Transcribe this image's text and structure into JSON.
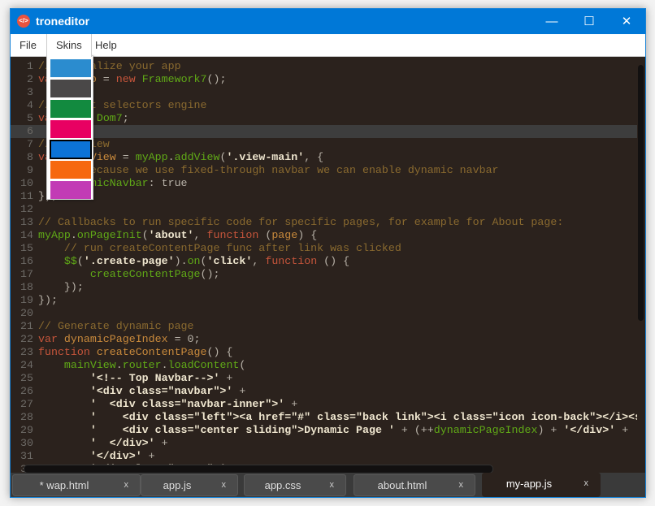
{
  "window": {
    "title": "troneditor",
    "logo_glyph": "</>"
  },
  "menu": [
    "File",
    "Skins",
    "Help"
  ],
  "skins": {
    "colors": [
      "#2b8ccf",
      "#4a4848",
      "#128a3f",
      "#e80062",
      "#0c73d6",
      "#f6680f",
      "#c23bb5"
    ],
    "selected_index": 4
  },
  "editor": {
    "current_line": 6,
    "lines": [
      [
        [
          "c",
          "// Initialize your app"
        ]
      ],
      [
        [
          "k",
          "var "
        ],
        [
          "v",
          "myApp"
        ],
        [
          "p",
          " = "
        ],
        [
          "k",
          "new "
        ],
        [
          "g",
          "Framework7"
        ],
        [
          "p",
          "();"
        ]
      ],
      [],
      [
        [
          "c",
          "// Export selectors engine"
        ]
      ],
      [
        [
          "k",
          "var "
        ],
        [
          "v",
          "$$"
        ],
        [
          "p",
          " = "
        ],
        [
          "g",
          "Dom7"
        ],
        [
          "p",
          ";"
        ]
      ],
      [],
      [
        [
          "c",
          "// Add view"
        ]
      ],
      [
        [
          "k",
          "var "
        ],
        [
          "v",
          "mainView"
        ],
        [
          "p",
          " = "
        ],
        [
          "g",
          "myApp"
        ],
        [
          "p",
          "."
        ],
        [
          "g",
          "addView"
        ],
        [
          "p",
          "("
        ],
        [
          "s",
          "'.view-main'"
        ],
        [
          "p",
          ", {"
        ]
      ],
      [
        [
          "c",
          "    // Because we use fixed-through navbar we can enable dynamic navbar"
        ]
      ],
      [
        [
          "p",
          "    "
        ],
        [
          "g",
          "dynamicNavbar"
        ],
        [
          "p",
          ": true"
        ]
      ],
      [
        [
          "p",
          "});"
        ]
      ],
      [],
      [
        [
          "c",
          "// Callbacks to run specific code for specific pages, for example for About page:"
        ]
      ],
      [
        [
          "g",
          "myApp"
        ],
        [
          "p",
          "."
        ],
        [
          "g",
          "onPageInit"
        ],
        [
          "p",
          "("
        ],
        [
          "s",
          "'about'"
        ],
        [
          "p",
          ", "
        ],
        [
          "k",
          "function"
        ],
        [
          "p",
          " ("
        ],
        [
          "v",
          "page"
        ],
        [
          "p",
          ") {"
        ]
      ],
      [
        [
          "c",
          "    // run createContentPage func after link was clicked"
        ]
      ],
      [
        [
          "p",
          "    "
        ],
        [
          "g",
          "$$"
        ],
        [
          "p",
          "("
        ],
        [
          "s",
          "'.create-page'"
        ],
        [
          "p",
          ")."
        ],
        [
          "g",
          "on"
        ],
        [
          "p",
          "("
        ],
        [
          "s",
          "'click'"
        ],
        [
          "p",
          ", "
        ],
        [
          "k",
          "function"
        ],
        [
          "p",
          " () {"
        ]
      ],
      [
        [
          "p",
          "        "
        ],
        [
          "g",
          "createContentPage"
        ],
        [
          "p",
          "();"
        ]
      ],
      [
        [
          "p",
          "    });"
        ]
      ],
      [
        [
          "p",
          "});"
        ]
      ],
      [],
      [
        [
          "c",
          "// Generate dynamic page"
        ]
      ],
      [
        [
          "k",
          "var "
        ],
        [
          "v",
          "dynamicPageIndex"
        ],
        [
          "p",
          " = 0;"
        ]
      ],
      [
        [
          "k",
          "function "
        ],
        [
          "v",
          "createContentPage"
        ],
        [
          "p",
          "() {"
        ]
      ],
      [
        [
          "p",
          "    "
        ],
        [
          "g",
          "mainView"
        ],
        [
          "p",
          "."
        ],
        [
          "g",
          "router"
        ],
        [
          "p",
          "."
        ],
        [
          "g",
          "loadContent"
        ],
        [
          "p",
          "("
        ]
      ],
      [
        [
          "p",
          "        "
        ],
        [
          "s",
          "'<!-- Top Navbar-->'"
        ],
        [
          "p",
          " +"
        ]
      ],
      [
        [
          "p",
          "        "
        ],
        [
          "s",
          "'<div class=\"navbar\">'"
        ],
        [
          "p",
          " +"
        ]
      ],
      [
        [
          "p",
          "        "
        ],
        [
          "s",
          "'  <div class=\"navbar-inner\">'"
        ],
        [
          "p",
          " +"
        ]
      ],
      [
        [
          "p",
          "        "
        ],
        [
          "s",
          "'    <div class=\"left\"><a href=\"#\" class=\"back link\"><i class=\"icon icon-back\"></i><span>Back</span></a></div>'"
        ]
      ],
      [
        [
          "p",
          "        "
        ],
        [
          "s",
          "'    <div class=\"center sliding\">Dynamic Page '"
        ],
        [
          "p",
          " + (++"
        ],
        [
          "g",
          "dynamicPageIndex"
        ],
        [
          "p",
          ") + "
        ],
        [
          "s",
          "'</div>'"
        ],
        [
          "p",
          " +"
        ]
      ],
      [
        [
          "p",
          "        "
        ],
        [
          "s",
          "'  </div>'"
        ],
        [
          "p",
          " +"
        ]
      ],
      [
        [
          "p",
          "        "
        ],
        [
          "s",
          "'</div>'"
        ],
        [
          "p",
          " +"
        ]
      ],
      [
        [
          "p",
          "        "
        ],
        [
          "s",
          "'<div class=\"pages\">'"
        ],
        [
          "p",
          " +"
        ]
      ]
    ]
  },
  "tabs": [
    {
      "label": "* wap.html",
      "close": "x"
    },
    {
      "label": "app.js",
      "close": "x"
    },
    {
      "label": "app.css",
      "close": "x"
    },
    {
      "label": "about.html",
      "close": "x"
    },
    {
      "label": "my-app.js",
      "close": "x",
      "active": true
    }
  ]
}
